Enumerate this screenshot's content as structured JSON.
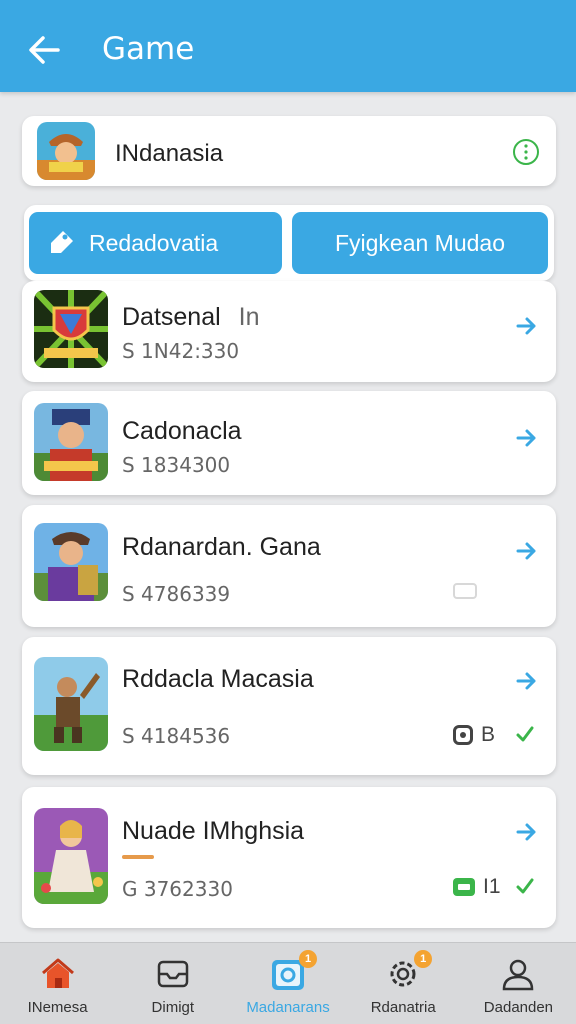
{
  "header": {
    "title": "Game",
    "back_icon": "back-arrow-icon"
  },
  "region": {
    "name": "INdanasia",
    "info_icon": "info-icon"
  },
  "actions": [
    {
      "label": "Redadovatia",
      "icon": "edit-tag-icon"
    },
    {
      "label": "Fyigkean Mudao"
    }
  ],
  "games": [
    {
      "name": "Datsenal",
      "tag": "In",
      "price": "S 1N42:330"
    },
    {
      "name": "Cadonacla",
      "price": "S 1834300"
    },
    {
      "name": "Rdanardan. Gana",
      "price": "S 4786339"
    },
    {
      "name": "Rddacla Macasia",
      "price": "S 4184536",
      "badge": "B"
    },
    {
      "name": "Nuade IMhghsia",
      "price": "G 3762330",
      "badge": "I1"
    }
  ],
  "nav": [
    {
      "label": "INemesa",
      "icon": "home-icon"
    },
    {
      "label": "Dimigt",
      "icon": "inbox-icon"
    },
    {
      "label": "Madanarans",
      "icon": "camera-icon",
      "badge": "1"
    },
    {
      "label": "Rdanatria",
      "icon": "gear-icon",
      "badge": "1"
    },
    {
      "label": "Dadanden",
      "icon": "user-icon"
    }
  ],
  "colors": {
    "primary": "#3aa8e3",
    "success": "#3bb54a",
    "orange": "#e69a4b"
  }
}
